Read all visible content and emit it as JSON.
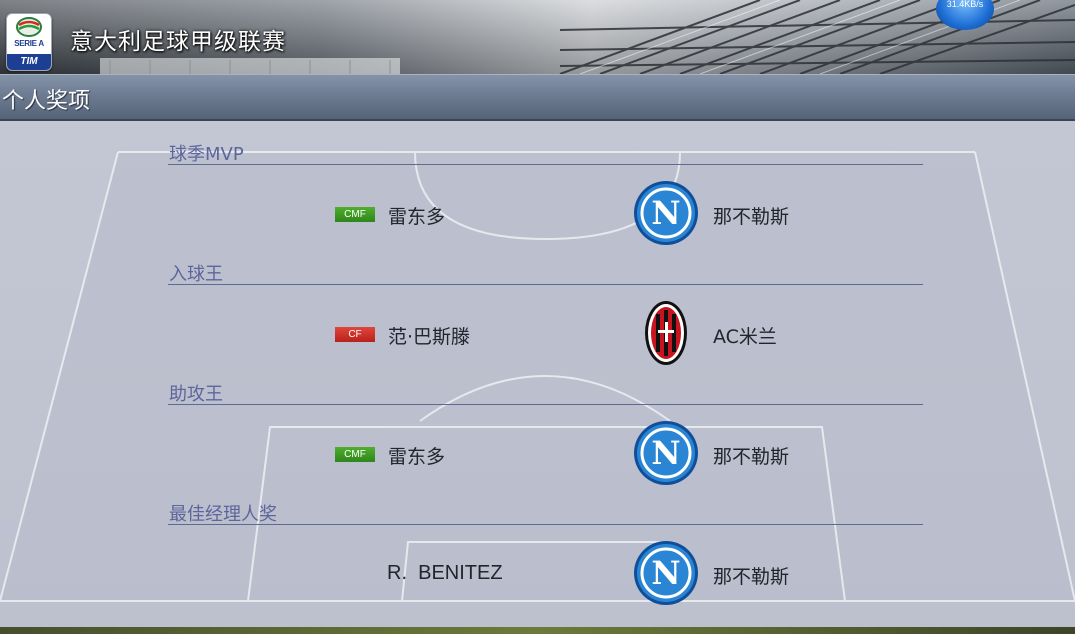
{
  "header": {
    "league_title": "意大利足球甲级联赛",
    "logo_text": "SERIE A",
    "logo_sponsor": "TIM",
    "speed_indicator": "31.4KB/s"
  },
  "section": {
    "title": "个人奖项"
  },
  "colors": {
    "award_title": "#5d669b",
    "cmf_badge": "#3a9a22",
    "cf_badge": "#cc2e26",
    "napoli_blue": "#1f78c8",
    "milan_red": "#c8141e"
  },
  "awards": [
    {
      "title": "球季MVP",
      "position": "CMF",
      "player": "雷东多",
      "club": "那不勒斯",
      "crest": "napoli-crest-icon"
    },
    {
      "title": "入球王",
      "position": "CF",
      "player": "范·巴斯滕",
      "club": "AC米兰",
      "crest": "ac-milan-crest-icon"
    },
    {
      "title": "助攻王",
      "position": "CMF",
      "player": "雷东多",
      "club": "那不勒斯",
      "crest": "napoli-crest-icon"
    },
    {
      "title": "最佳经理人奖",
      "position": "",
      "player": "R.  BENITEZ",
      "club": "那不勒斯",
      "crest": "napoli-crest-icon"
    }
  ]
}
